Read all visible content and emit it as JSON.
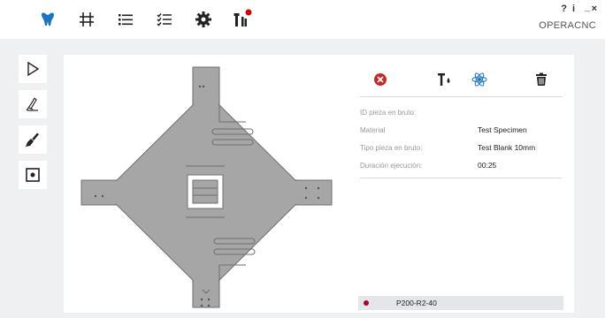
{
  "window": {
    "help_label": "?",
    "info_label": "i",
    "minimize_label": "_",
    "close_label": "×",
    "brand": "OPERACNC"
  },
  "colors": {
    "accent": "#1e73be",
    "danger": "#c62828",
    "notification": "#d50000",
    "part_fill": "#a6a6a6"
  },
  "topbar_icons": [
    "tooth-icon",
    "sliders-icon",
    "list-icon",
    "checklist-icon",
    "gear-icon",
    "tools-icon"
  ],
  "sidebar_icons": [
    "play-icon",
    "scraper-icon",
    "brush-icon",
    "target-icon"
  ],
  "actions": [
    "cancel-icon",
    "tool-drop-icon",
    "atom-icon",
    "trash-icon"
  ],
  "info": {
    "id_label": "ID pieza en bruto:",
    "id_value": "",
    "material_label": "Material",
    "material_value": "Test Specimen",
    "type_label": "Tipo pieza en bruto:",
    "type_value": "Test Blank 10mm",
    "duration_label": "Duración ejecución:",
    "duration_value": "00:25"
  },
  "status": {
    "program": "P200-R2-40"
  }
}
